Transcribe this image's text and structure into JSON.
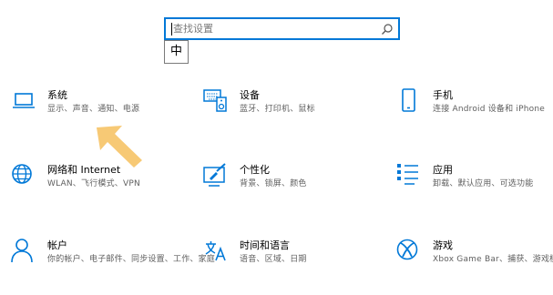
{
  "search": {
    "placeholder": "查找设置"
  },
  "ime": {
    "label": "中"
  },
  "tiles": [
    {
      "title": "系统",
      "desc": "显示、声音、通知、电源",
      "icon": "laptop-icon"
    },
    {
      "title": "设备",
      "desc": "蓝牙、打印机、鼠标",
      "icon": "keyboard-speaker-icon"
    },
    {
      "title": "手机",
      "desc": "连接 Android 设备和 iPhone",
      "icon": "phone-icon"
    },
    {
      "title": "网络和 Internet",
      "desc": "WLAN、飞行模式、VPN",
      "icon": "globe-icon"
    },
    {
      "title": "个性化",
      "desc": "背景、锁屏、颜色",
      "icon": "paintbrush-icon"
    },
    {
      "title": "应用",
      "desc": "卸载、默认应用、可选功能",
      "icon": "apps-list-icon"
    },
    {
      "title": "帐户",
      "desc": "你的帐户、电子邮件、同步设置、工作、家庭",
      "icon": "person-icon"
    },
    {
      "title": "时间和语言",
      "desc": "语音、区域、日期",
      "icon": "time-language-icon"
    },
    {
      "title": "游戏",
      "desc": "Xbox Game Bar、捕获、游戏模式",
      "icon": "xbox-icon"
    }
  ],
  "colors": {
    "accent": "#0078d7",
    "arrow": "#f6c469"
  }
}
